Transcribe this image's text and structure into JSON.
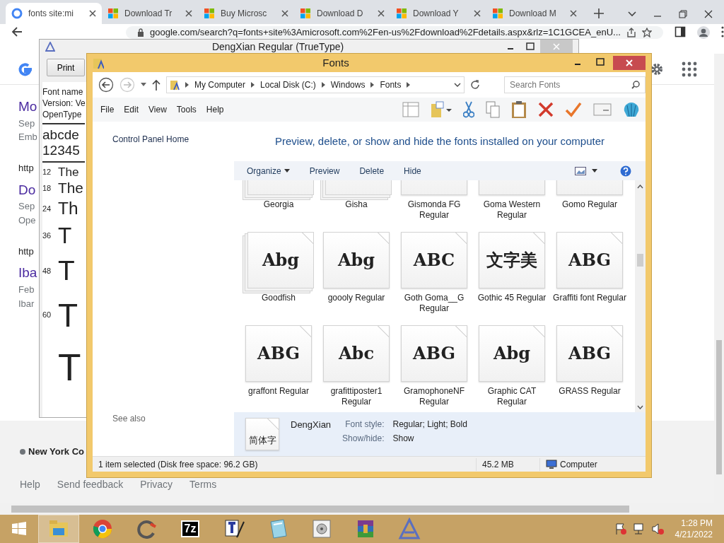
{
  "browser": {
    "tabs": [
      {
        "label": "fonts site:mi",
        "selected": true,
        "kind": "google"
      },
      {
        "label": "Download Tr",
        "selected": false,
        "kind": "squares"
      },
      {
        "label": "Buy Microsc",
        "selected": false,
        "kind": "squares"
      },
      {
        "label": "Download D",
        "selected": false,
        "kind": "squares"
      },
      {
        "label": "Download Y",
        "selected": false,
        "kind": "squares"
      },
      {
        "label": "Download M",
        "selected": false,
        "kind": "squares"
      }
    ],
    "url": "google.com/search?q=fonts+site%3Amicrosoft.com%2Fen-us%2Fdownload%2Fdetails.aspx&rlz=1C1GCEA_enU...",
    "results": [
      {
        "kind": "title",
        "text": "Mo"
      },
      {
        "kind": "meta",
        "text": "Sep"
      },
      {
        "kind": "meta",
        "text": "Emb"
      },
      {
        "kind": "url",
        "text": "http"
      },
      {
        "kind": "title",
        "text": "Do"
      },
      {
        "kind": "meta",
        "text": "Sep"
      },
      {
        "kind": "meta",
        "text": "Ope"
      },
      {
        "kind": "url",
        "text": "http"
      },
      {
        "kind": "title",
        "text": "Iba"
      },
      {
        "kind": "meta",
        "text": "Feb"
      },
      {
        "kind": "meta",
        "text": "Ibar"
      }
    ],
    "footer": {
      "location": "New York Co",
      "links": [
        "Help",
        "Send feedback",
        "Privacy",
        "Terms"
      ]
    }
  },
  "font_viewer": {
    "title": "DengXian Regular (TrueType)",
    "print_button": "Print",
    "info": [
      "Font name",
      "Version: Ve",
      "OpenType"
    ],
    "samples": [
      "abcde",
      "12345"
    ],
    "sizes": [
      {
        "size": "12",
        "text": "The"
      },
      {
        "size": "18",
        "text": "The"
      },
      {
        "size": "24",
        "text": "Th"
      },
      {
        "size": "36",
        "text": "T"
      },
      {
        "size": "48",
        "text": "T"
      },
      {
        "size": "60",
        "text": "T"
      },
      {
        "text": "T"
      }
    ]
  },
  "fonts_window": {
    "title": "Fonts",
    "breadcrumb": [
      "My Computer",
      "Local Disk (C:)",
      "Windows",
      "Fonts"
    ],
    "search_placeholder": "Search Fonts",
    "menu": [
      "File",
      "Edit",
      "View",
      "Tools",
      "Help"
    ],
    "nav_link": "Control Panel Home",
    "see_also": "See also",
    "heading": "Preview, delete, or show and hide the fonts installed on your computer",
    "commands": [
      {
        "label": "Organize",
        "dropdown": true
      },
      {
        "label": "Preview",
        "dropdown": false
      },
      {
        "label": "Delete",
        "dropdown": false
      },
      {
        "label": "Hide",
        "dropdown": false
      }
    ],
    "fonts": [
      {
        "name": "Georgia",
        "kind": "family"
      },
      {
        "name": "Gisha",
        "kind": "family"
      },
      {
        "name": "Gismonda FG Regular",
        "kind": "single"
      },
      {
        "name": "Goma Western Regular",
        "kind": "single"
      },
      {
        "name": "Gomo Regular",
        "kind": "single"
      },
      {
        "name": "Goodfish",
        "kind": "family",
        "preview": "Abg"
      },
      {
        "name": "goooly Regular",
        "kind": "single",
        "preview": "Abg"
      },
      {
        "name": "Goth Goma__G Regular",
        "kind": "single",
        "preview": "ABC"
      },
      {
        "name": "Gothic 45 Regular",
        "kind": "single",
        "preview": "文字美"
      },
      {
        "name": "Graffiti font Regular",
        "kind": "single",
        "preview": "ABG"
      },
      {
        "name": "graffont Regular",
        "kind": "single",
        "preview": "ABG"
      },
      {
        "name": "grafittiposter1 Regular",
        "kind": "single",
        "preview": "Abc"
      },
      {
        "name": "GramophoneNF Regular",
        "kind": "single",
        "preview": "ABG"
      },
      {
        "name": "Graphic CAT Regular",
        "kind": "single",
        "preview": "Abg"
      },
      {
        "name": "GRASS Regular",
        "kind": "single",
        "preview": "ABG"
      }
    ],
    "details": {
      "preview": "简体字",
      "name": "DengXian",
      "fields": [
        {
          "label": "Font style:",
          "value": "Regular; Light; Bold"
        },
        {
          "label": "Show/hide:",
          "value": "Show"
        }
      ]
    },
    "status": {
      "selection": "1 item selected (Disk free space: 96.2 GB)",
      "size": "45.2 MB",
      "zone": "Computer"
    }
  },
  "taskbar": {
    "apps": [
      {
        "kind": "folder",
        "active": true
      },
      {
        "kind": "chrome",
        "active": false
      },
      {
        "kind": "swirl",
        "active": false
      },
      {
        "kind": "sevenzip",
        "label": "7z",
        "active": false
      },
      {
        "kind": "pen",
        "active": false
      },
      {
        "kind": "notepad",
        "active": false
      },
      {
        "kind": "disk",
        "active": false
      },
      {
        "kind": "archive",
        "active": false
      },
      {
        "kind": "font",
        "active": false
      }
    ],
    "time": "1:28 PM",
    "date": "4/21/2022"
  }
}
